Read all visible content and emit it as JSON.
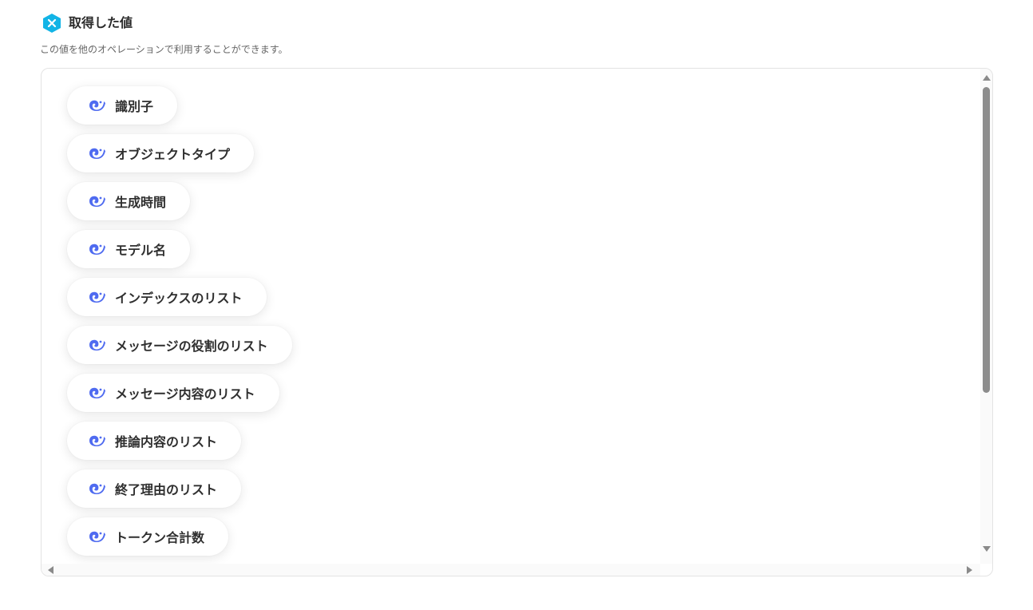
{
  "header": {
    "icon": "yoom-hex-logo-icon",
    "title": "取得した値",
    "subtitle": "この値を他のオペレーションで利用することができます。"
  },
  "colors": {
    "accent": "#12b4e6",
    "chip_icon": "#4f6bf0",
    "text": "#2f2f2f"
  },
  "values": {
    "chip_icon": "deepseek-whale-icon",
    "items": [
      {
        "label": "識別子"
      },
      {
        "label": "オブジェクトタイプ"
      },
      {
        "label": "生成時間"
      },
      {
        "label": "モデル名"
      },
      {
        "label": "インデックスのリスト"
      },
      {
        "label": "メッセージの役割のリスト"
      },
      {
        "label": "メッセージ内容のリスト"
      },
      {
        "label": "推論内容のリスト"
      },
      {
        "label": "終了理由のリスト"
      },
      {
        "label": "トークン合計数"
      }
    ]
  }
}
